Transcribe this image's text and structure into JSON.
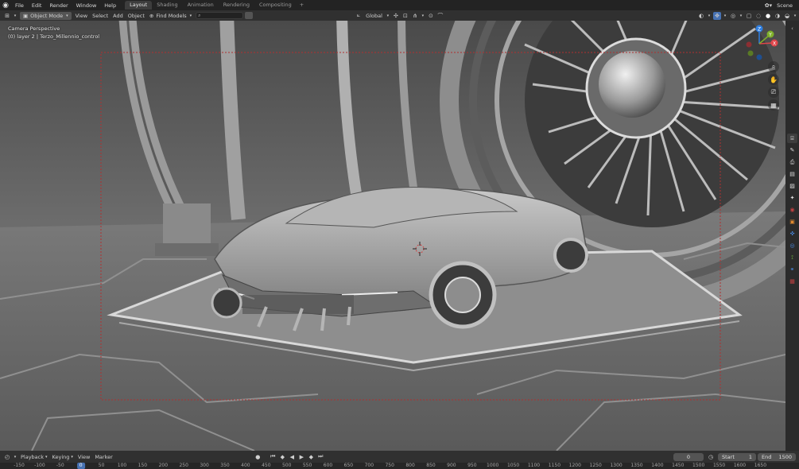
{
  "menubar": {
    "menus": [
      "File",
      "Edit",
      "Render",
      "Window",
      "Help"
    ],
    "tabs": [
      {
        "label": "Layout",
        "active": true
      },
      {
        "label": "Shading",
        "active": false
      },
      {
        "label": "Animation",
        "active": false
      },
      {
        "label": "Rendering",
        "active": false
      },
      {
        "label": "Compositing",
        "active": false
      }
    ],
    "add_tab": "+",
    "scene": "Scene"
  },
  "header": {
    "mode": "Object Mode",
    "menus": [
      "View",
      "Select",
      "Add",
      "Object"
    ],
    "find_models": "Find Models",
    "orientation": "Global"
  },
  "viewport": {
    "camera_label": "Camera Perspective",
    "object_label": "(0) layer 2 | Terzo_Millennio_control"
  },
  "gizmo": {
    "z_label": "Z",
    "x_label": "X",
    "y_label": "Y"
  },
  "timeline": {
    "menus": [
      "Playback",
      "Keying",
      "View",
      "Marker"
    ],
    "current_frame": "0",
    "start_label": "Start",
    "start_value": "1",
    "end_label": "End",
    "end_value": "1500",
    "ruler": [
      "-150",
      "-100",
      "-50",
      "0",
      "50",
      "100",
      "150",
      "200",
      "250",
      "300",
      "350",
      "400",
      "450",
      "500",
      "550",
      "600",
      "650",
      "700",
      "750",
      "800",
      "850",
      "900",
      "950",
      "1000",
      "1050",
      "1100",
      "1150",
      "1200",
      "1250",
      "1300",
      "1350",
      "1400",
      "1450",
      "1500",
      "1550",
      "1600",
      "1650"
    ]
  },
  "colors": {
    "accent": "#4772b3",
    "camera_frame": "#b03030",
    "axis_x": "#e0454a",
    "axis_y": "#7fb02a",
    "axis_z": "#2f7fe0"
  }
}
